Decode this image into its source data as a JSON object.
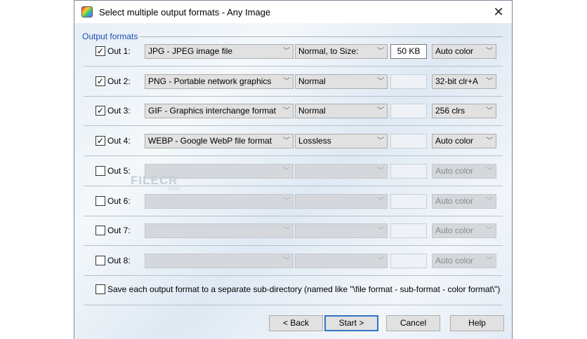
{
  "window": {
    "title": "Select multiple output formats - Any Image",
    "close": "✕"
  },
  "group": {
    "legend": "Output formats"
  },
  "outputs": [
    {
      "label": "Out 1:",
      "checked": true,
      "format": "JPG - JPEG image file",
      "subformat": "Normal, to Size:",
      "size": "50 KB",
      "color": "Auto color"
    },
    {
      "label": "Out 2:",
      "checked": true,
      "format": "PNG - Portable network graphics",
      "subformat": "Normal",
      "size": "",
      "color": "32-bit clr+A"
    },
    {
      "label": "Out 3:",
      "checked": true,
      "format": "GIF - Graphics interchange format",
      "subformat": "Normal",
      "size": "",
      "color": "256 clrs"
    },
    {
      "label": "Out 4:",
      "checked": true,
      "format": "WEBP - Google WebP file format",
      "subformat": "Lossless",
      "size": "",
      "color": "Auto color"
    },
    {
      "label": "Out 5:",
      "checked": false,
      "format": "",
      "subformat": "",
      "size": "",
      "color": "Auto color"
    },
    {
      "label": "Out 6:",
      "checked": false,
      "format": "",
      "subformat": "",
      "size": "",
      "color": "Auto color"
    },
    {
      "label": "Out 7:",
      "checked": false,
      "format": "",
      "subformat": "",
      "size": "",
      "color": "Auto color"
    },
    {
      "label": "Out 8:",
      "checked": false,
      "format": "",
      "subformat": "",
      "size": "",
      "color": "Auto color"
    }
  ],
  "subdir": {
    "checked": false,
    "label": "Save each output format to a separate sub-directory (named like \"\\file format - sub-format - color format\\\")"
  },
  "buttons": {
    "back": "< Back",
    "start": "Start >",
    "cancel": "Cancel",
    "help": "Help"
  },
  "watermark": {
    "text": "FILECR",
    "sub": ".com"
  }
}
